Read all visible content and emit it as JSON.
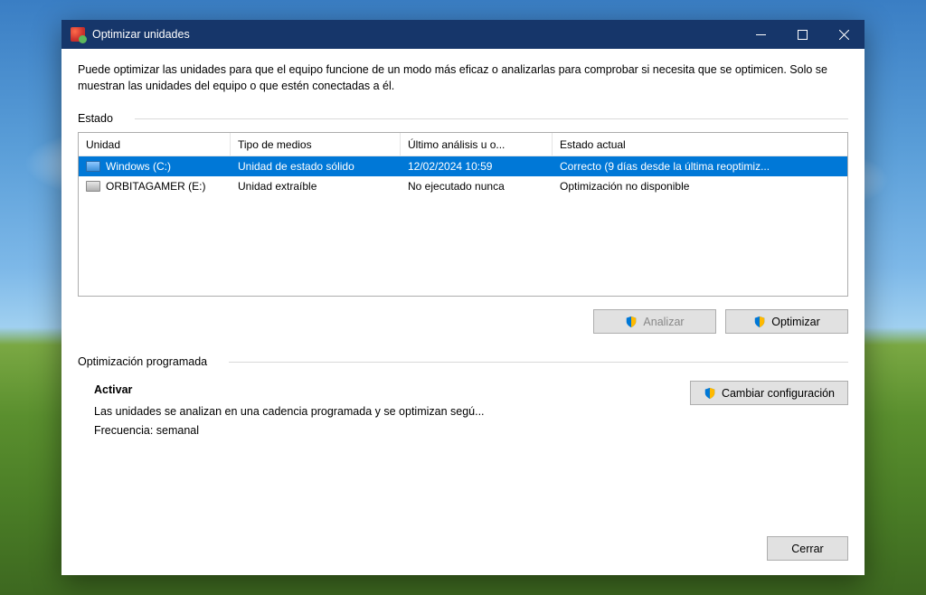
{
  "window": {
    "title": "Optimizar unidades"
  },
  "intro": "Puede optimizar las unidades para que el equipo funcione de un modo más eficaz o analizarlas para comprobar si necesita que se optimicen. Solo se muestran las unidades del equipo o que estén conectadas a él.",
  "section_status": "Estado",
  "columns": {
    "drive": "Unidad",
    "media": "Tipo de medios",
    "last": "Último análisis u o...",
    "state": "Estado actual"
  },
  "rows": [
    {
      "name": "Windows (C:)",
      "icon": "ssd",
      "media": "Unidad de estado sólido",
      "last": "12/02/2024 10:59",
      "state": "Correcto (9 días desde la última reoptimiz...",
      "selected": true
    },
    {
      "name": "ORBITAGAMER (E:)",
      "icon": "usb",
      "media": "Unidad extraíble",
      "last": "No ejecutado nunca",
      "state": "Optimización no disponible",
      "selected": false
    }
  ],
  "buttons": {
    "analyze": "Analizar",
    "optimize": "Optimizar",
    "change_settings": "Cambiar configuración",
    "close": "Cerrar"
  },
  "analyze_disabled": true,
  "section_schedule": "Optimización programada",
  "schedule": {
    "title": "Activar",
    "desc": "Las unidades se analizan en una cadencia programada y se optimizan segú...",
    "freq": "Frecuencia: semanal"
  }
}
